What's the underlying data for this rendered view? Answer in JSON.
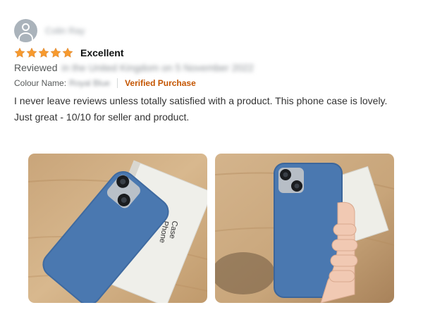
{
  "review": {
    "profile_name": "Colin Ray",
    "rating": 5,
    "rating_max": 5,
    "title": "Excellent",
    "reviewed_label": "Reviewed",
    "reviewed_detail": "in the United Kingdom on 5 November 2022",
    "colour_label": "Colour Name:",
    "colour_value": "Royal Blue",
    "verified_label": "Verified Purchase",
    "body_lines": [
      "I never leave reviews unless totally satisfied with a product. This phone case is lovely.",
      "Just great - 10/10 for seller and product."
    ],
    "box_text": [
      "Phone",
      "Case"
    ]
  },
  "colors": {
    "star": "#f79a2e",
    "verified": "#c45500",
    "case_blue": "#4a78b0",
    "avatar": "#aab3bb"
  },
  "icons": {
    "avatar": "person-icon",
    "star": "star-icon"
  }
}
